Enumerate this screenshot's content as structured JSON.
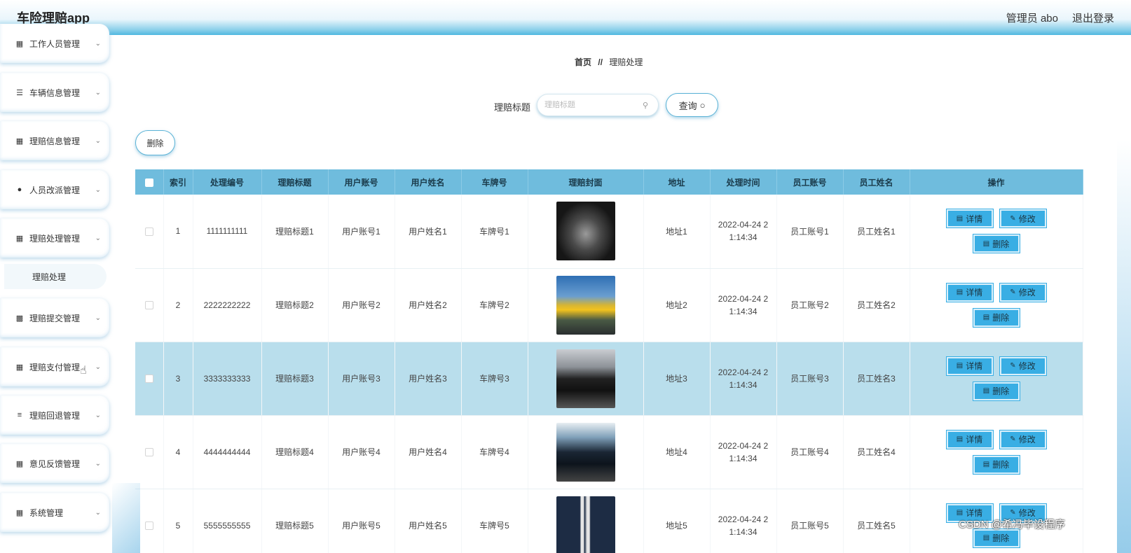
{
  "header": {
    "title": "车险理赔app",
    "admin_label": "管理员 abo",
    "logout_label": "退出登录"
  },
  "sidebar": {
    "items": [
      {
        "label": "工作人员管理",
        "icon": "grid-icon"
      },
      {
        "label": "车辆信息管理",
        "icon": "list-icon"
      },
      {
        "label": "理赔信息管理",
        "icon": "grid-icon"
      },
      {
        "label": "人员改派管理",
        "icon": "user-icon"
      },
      {
        "label": "理赔处理管理",
        "icon": "grid-icon"
      },
      {
        "label": "理赔提交管理",
        "icon": "chart-icon"
      },
      {
        "label": "理赔支付管理",
        "icon": "apps-icon"
      },
      {
        "label": "理赔回退管理",
        "icon": "sliders-icon"
      },
      {
        "label": "意见反馈管理",
        "icon": "grid-icon"
      },
      {
        "label": "系统管理",
        "icon": "grid-icon"
      }
    ],
    "submenu": {
      "label": "理赔处理"
    }
  },
  "breadcrumb": {
    "home": "首页",
    "separator": "//",
    "current": "理赔处理"
  },
  "search": {
    "label": "理赔标题",
    "placeholder": "理赔标题",
    "query_label": "查询"
  },
  "toolbar": {
    "delete_label": "删除"
  },
  "table": {
    "columns": [
      "索引",
      "处理编号",
      "理赔标题",
      "用户账号",
      "用户姓名",
      "车牌号",
      "理赔封面",
      "地址",
      "处理时间",
      "员工账号",
      "员工姓名",
      "操作"
    ],
    "rows": [
      {
        "index": "1",
        "code": "1111111111",
        "title": "理赔标题1",
        "account": "用户账号1",
        "name": "用户姓名1",
        "plate": "车牌号1",
        "address": "地址1",
        "time_a": "2022-04-24 2",
        "time_b": "1:14:34",
        "emp_account": "员工账号1",
        "emp_name": "员工姓名1"
      },
      {
        "index": "2",
        "code": "2222222222",
        "title": "理赔标题2",
        "account": "用户账号2",
        "name": "用户姓名2",
        "plate": "车牌号2",
        "address": "地址2",
        "time_a": "2022-04-24 2",
        "time_b": "1:14:34",
        "emp_account": "员工账号2",
        "emp_name": "员工姓名2"
      },
      {
        "index": "3",
        "code": "3333333333",
        "title": "理赔标题3",
        "account": "用户账号3",
        "name": "用户姓名3",
        "plate": "车牌号3",
        "address": "地址3",
        "time_a": "2022-04-24 2",
        "time_b": "1:14:34",
        "emp_account": "员工账号3",
        "emp_name": "员工姓名3"
      },
      {
        "index": "4",
        "code": "4444444444",
        "title": "理赔标题4",
        "account": "用户账号4",
        "name": "用户姓名4",
        "plate": "车牌号4",
        "address": "地址4",
        "time_a": "2022-04-24 2",
        "time_b": "1:14:34",
        "emp_account": "员工账号4",
        "emp_name": "员工姓名4"
      },
      {
        "index": "5",
        "code": "5555555555",
        "title": "理赔标题5",
        "account": "用户账号5",
        "name": "用户姓名5",
        "plate": "车牌号5",
        "address": "地址5",
        "time_a": "2022-04-24 2",
        "time_b": "1:14:34",
        "emp_account": "员工账号5",
        "emp_name": "员工姓名5"
      }
    ],
    "actions": {
      "detail": "详情",
      "edit": "修改",
      "delete": "删除"
    }
  },
  "watermark": "CSDN @希冯毕设程序",
  "colors": {
    "accent": "#39aee4",
    "header_blue": "#6fbcdd",
    "highlight_row": "#b9deec"
  }
}
